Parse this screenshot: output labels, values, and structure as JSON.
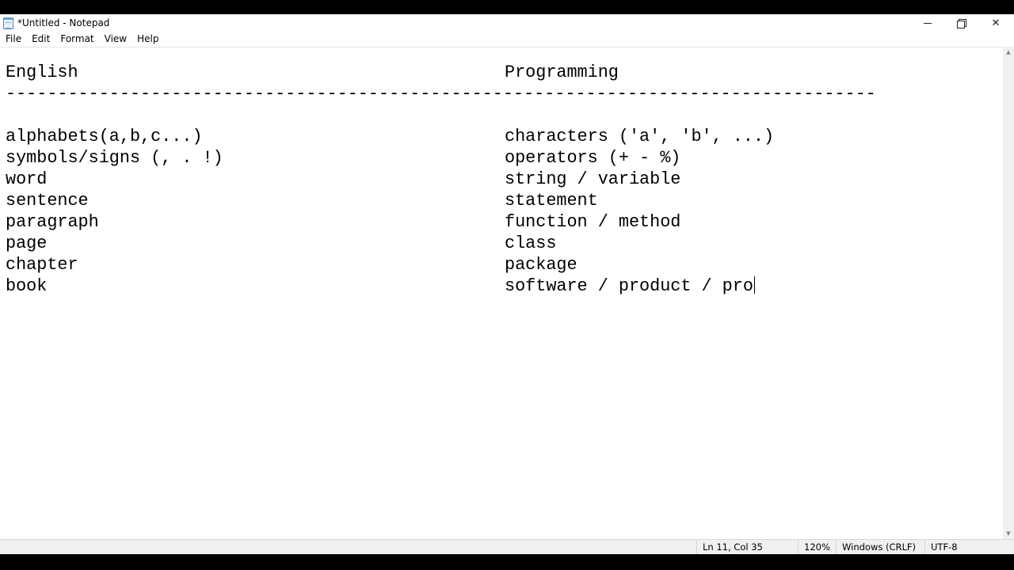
{
  "window": {
    "title": "*Untitled - Notepad",
    "controls": {
      "minimize": "—",
      "close": "✕"
    }
  },
  "menu": {
    "file": "File",
    "edit": "Edit",
    "format": "Format",
    "view": "View",
    "help": "Help"
  },
  "editor": {
    "header": {
      "left": "English",
      "right": "Programming"
    },
    "separator": "------------------------------------------------------------------------------------",
    "rows": [
      {
        "left": "alphabets(a,b,c...)",
        "right": "characters ('a', 'b', ...)"
      },
      {
        "left": "symbols/signs (, . !)",
        "right": "operators (+ - %)"
      },
      {
        "left": "word",
        "right": "string / variable"
      },
      {
        "left": "sentence",
        "right": "statement"
      },
      {
        "left": "paragraph",
        "right": "function / method"
      },
      {
        "left": "page",
        "right": "class"
      },
      {
        "left": "chapter",
        "right": "package"
      },
      {
        "left": "book",
        "right": "software / product / pro"
      }
    ]
  },
  "statusbar": {
    "position": "Ln 11, Col 35",
    "zoom": "120%",
    "line_ending": "Windows (CRLF)",
    "encoding": "UTF-8"
  },
  "icons": {
    "app": "notepad-icon",
    "minimize": "minimize-icon",
    "maximize": "restore-icon",
    "close": "close-icon",
    "scroll_up": "chevron-up-icon",
    "scroll_down": "chevron-down-icon"
  },
  "scroll_arrows": {
    "up": "▲",
    "down": "▼"
  }
}
